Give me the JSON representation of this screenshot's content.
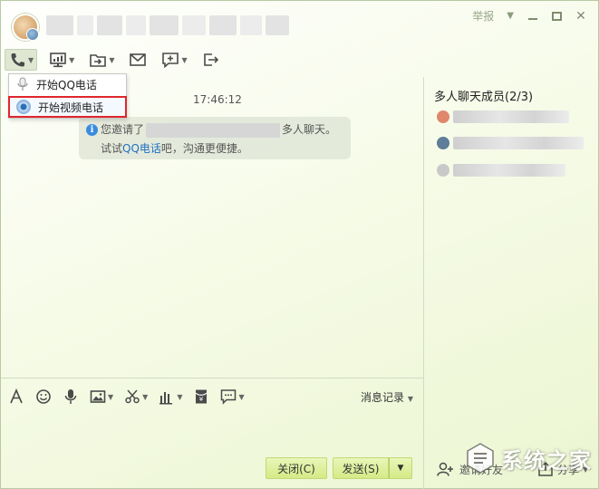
{
  "titlebar": {
    "report_label": "举报"
  },
  "dropdown": {
    "items": [
      {
        "label": "开始QQ电话"
      },
      {
        "label": "开始视频电话"
      }
    ]
  },
  "chat": {
    "timestamp": "17:46:12",
    "notice": {
      "line1_prefix": "您邀请了",
      "line1_suffix": "多人聊天。",
      "line2_prefix": "试试",
      "line2_link": "QQ电话",
      "line2_suffix": "吧，沟通更便捷。"
    }
  },
  "members": {
    "title": "多人聊天成员(2/3)"
  },
  "input_toolbar": {
    "history_label": "消息记录"
  },
  "buttons": {
    "close_label": "关闭(C)",
    "send_label": "发送(S)",
    "add_friend_label": "邀请好友",
    "share_label": "分享"
  },
  "watermark": {
    "text": "系统之家"
  },
  "colors": {
    "link": "#1f6fc0",
    "highlight_border": "#e0262b",
    "button_green": "#d5ea86"
  }
}
